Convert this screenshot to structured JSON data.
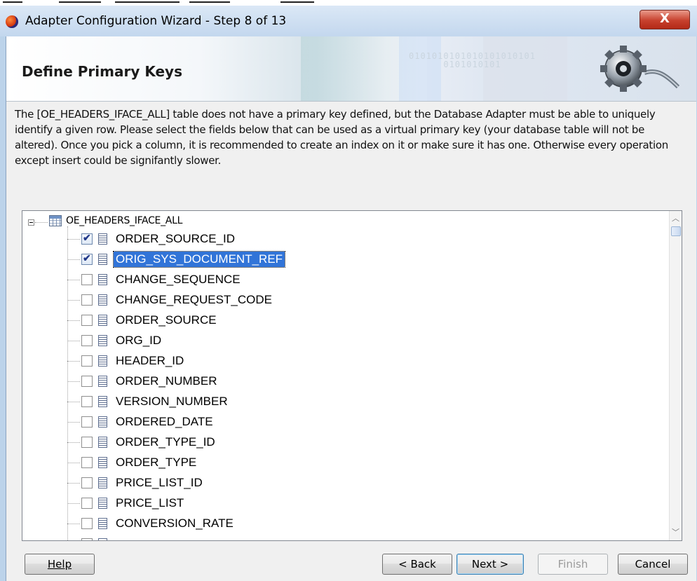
{
  "window": {
    "title": "Adapter Configuration Wizard - Step 8 of 13",
    "close_label": "X"
  },
  "banner": {
    "title": "Define Primary Keys",
    "binary": "0101010101010101010101\n      0101010101"
  },
  "description": "The [OE_HEADERS_IFACE_ALL] table does not have a primary key defined, but the Database Adapter must be able to uniquely identify a given row.  Please select the fields below that can be used as a virtual primary key (your database table will not be altered).  Once you pick a column, it is recommended to create an index on it or make sure it has one.  Otherwise every operation except insert could be signifantly slower.",
  "tree": {
    "root": "OE_HEADERS_IFACE_ALL",
    "columns": [
      {
        "name": "ORDER_SOURCE_ID",
        "checked": true,
        "selected": false
      },
      {
        "name": "ORIG_SYS_DOCUMENT_REF",
        "checked": true,
        "selected": true
      },
      {
        "name": "CHANGE_SEQUENCE",
        "checked": false,
        "selected": false
      },
      {
        "name": "CHANGE_REQUEST_CODE",
        "checked": false,
        "selected": false
      },
      {
        "name": "ORDER_SOURCE",
        "checked": false,
        "selected": false
      },
      {
        "name": "ORG_ID",
        "checked": false,
        "selected": false
      },
      {
        "name": "HEADER_ID",
        "checked": false,
        "selected": false
      },
      {
        "name": "ORDER_NUMBER",
        "checked": false,
        "selected": false
      },
      {
        "name": "VERSION_NUMBER",
        "checked": false,
        "selected": false
      },
      {
        "name": "ORDERED_DATE",
        "checked": false,
        "selected": false
      },
      {
        "name": "ORDER_TYPE_ID",
        "checked": false,
        "selected": false
      },
      {
        "name": "ORDER_TYPE",
        "checked": false,
        "selected": false
      },
      {
        "name": "PRICE_LIST_ID",
        "checked": false,
        "selected": false
      },
      {
        "name": "PRICE_LIST",
        "checked": false,
        "selected": false
      },
      {
        "name": "CONVERSION_RATE",
        "checked": false,
        "selected": false
      }
    ]
  },
  "buttons": {
    "help": "Help",
    "back": "< Back",
    "next": "Next >",
    "finish": "Finish",
    "cancel": "Cancel"
  },
  "colors": {
    "selection": "#3174d8",
    "close_button": "#c7402d"
  }
}
